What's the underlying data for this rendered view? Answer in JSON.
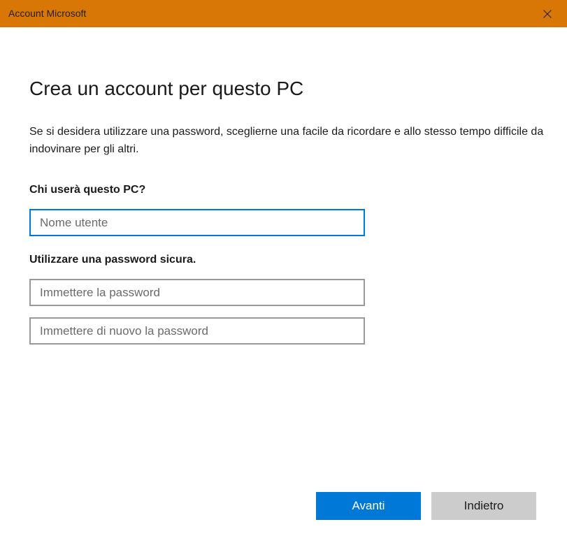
{
  "window": {
    "title": "Account Microsoft",
    "close_icon": "close-icon"
  },
  "form": {
    "heading": "Crea un account per questo PC",
    "description": "Se si desidera utilizzare una password, sceglierne una facile da ricordare e allo stesso tempo difficile da indovinare per gli altri.",
    "user_label": "Chi userà questo PC?",
    "user_placeholder": "Nome utente",
    "password_label": "Utilizzare una password sicura.",
    "password_placeholder": "Immettere la password",
    "password_confirm_placeholder": "Immettere di nuovo la password"
  },
  "buttons": {
    "next_label": "Avanti",
    "back_label": "Indietro"
  },
  "colors": {
    "titlebar": "#d97706",
    "accent": "#0078d7",
    "secondary_button": "#cccccc"
  }
}
